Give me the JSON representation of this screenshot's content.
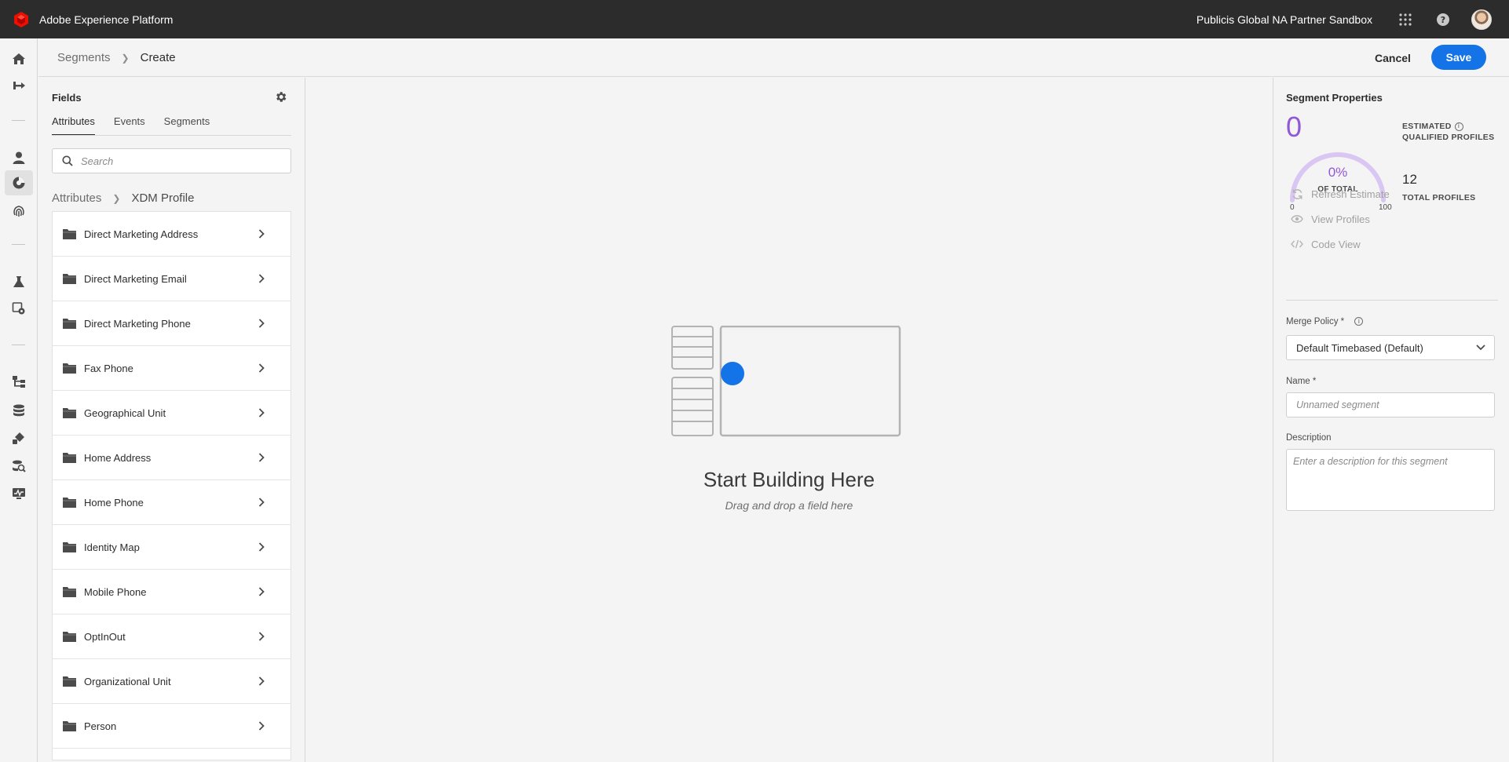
{
  "topbar": {
    "app_title": "Adobe Experience Platform",
    "org_name": "Publicis Global NA Partner Sandbox",
    "icons": [
      "apps-grid-icon",
      "help-icon",
      "user-avatar"
    ],
    "brand_color": "#eb1000"
  },
  "rail": {
    "icons": [
      "home-icon",
      "sources-icon",
      "profiles-icon",
      "segments-icon",
      "identities-icon",
      "data-science-icon",
      "settings-icon",
      "workflows-icon",
      "datasets-icon",
      "destinations-icon",
      "queries-icon",
      "monitoring-icon"
    ],
    "active": "segments-icon"
  },
  "header": {
    "breadcrumb_parent": "Segments",
    "breadcrumb_current": "Create",
    "cancel_label": "Cancel",
    "save_label": "Save"
  },
  "fields": {
    "title": "Fields",
    "tabs": [
      {
        "label": "Attributes",
        "active": true
      },
      {
        "label": "Events",
        "active": false
      },
      {
        "label": "Segments",
        "active": false
      }
    ],
    "search_placeholder": "Search",
    "breadcrumb_root": "Attributes",
    "breadcrumb_current": "XDM Profile",
    "items": [
      "Direct Marketing Address",
      "Direct Marketing Email",
      "Direct Marketing Phone",
      "Fax Phone",
      "Geographical Unit",
      "Home Address",
      "Home Phone",
      "Identity Map",
      "Mobile Phone",
      "OptInOut",
      "Organizational Unit",
      "Person"
    ]
  },
  "canvas": {
    "title": "Start Building Here",
    "subtitle": "Drag and drop a field here"
  },
  "properties": {
    "title": "Segment Properties",
    "estimated_value": "0",
    "estimated_label_line1": "ESTIMATED",
    "estimated_label_line2": "QUALIFIED PROFILES",
    "gauge_percent": "0%",
    "gauge_fraction": 0,
    "gauge_caption": "OF TOTAL",
    "gauge_min": "0",
    "gauge_max": "100",
    "total_profiles": "12",
    "total_label": "TOTAL PROFILES",
    "actions": [
      "Refresh Estimate",
      "View Profiles",
      "Code View"
    ],
    "merge_policy_label": "Merge Policy *",
    "merge_policy_value": "Default Timebased (Default)",
    "name_label": "Name *",
    "name_placeholder": "Unnamed segment",
    "description_label": "Description",
    "description_placeholder": "Enter a description for this segment",
    "accent_color": "#9256d9"
  },
  "colors": {
    "primary": "#1473e6",
    "topbar": "#2c2c2c",
    "background": "#f4f4f4"
  }
}
